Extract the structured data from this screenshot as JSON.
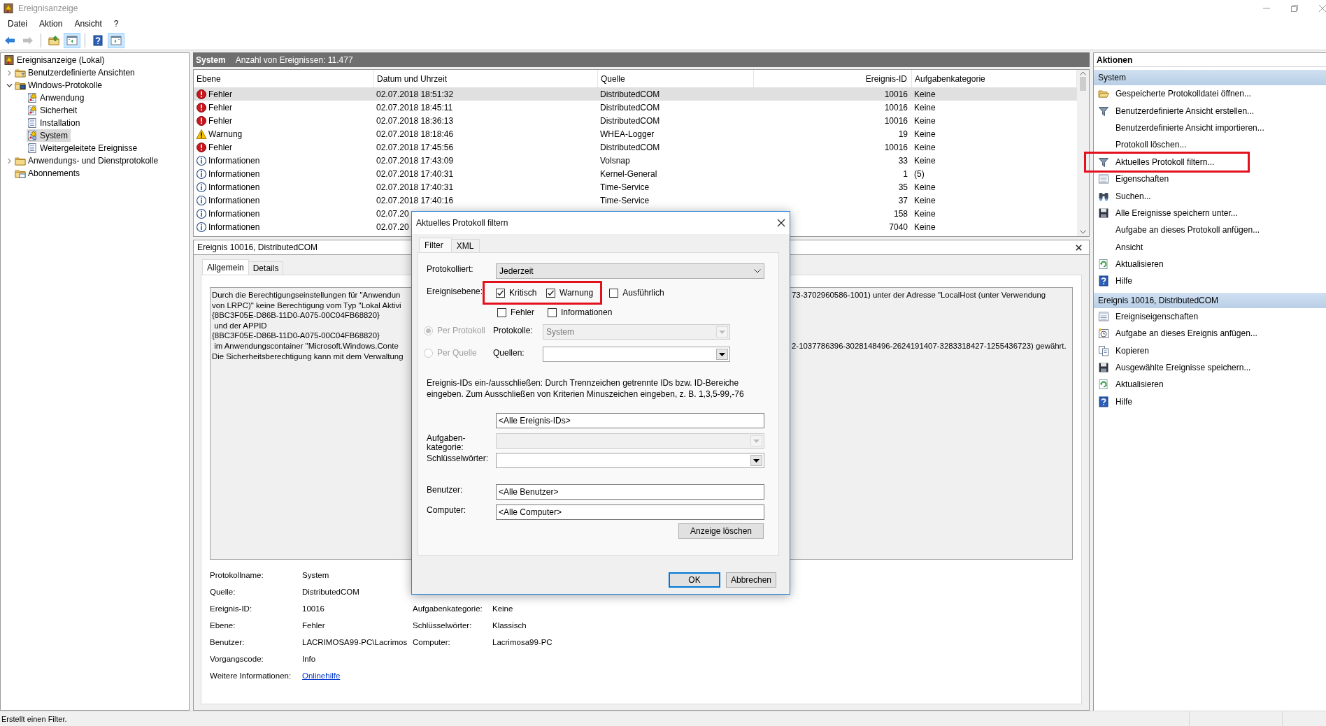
{
  "window": {
    "title": "Ereignisanzeige"
  },
  "menu": [
    "Datei",
    "Aktion",
    "Ansicht",
    "?"
  ],
  "toolbar": [
    {
      "kind": "back",
      "pressed": false,
      "disabled": false
    },
    {
      "kind": "forward",
      "pressed": false,
      "disabled": true
    },
    {
      "kind": "up",
      "pressed": false,
      "disabled": false
    },
    {
      "kind": "tree-pane",
      "pressed": true,
      "disabled": false
    },
    {
      "kind": "help",
      "pressed": false,
      "disabled": false
    },
    {
      "kind": "action-pane",
      "pressed": true,
      "disabled": false
    }
  ],
  "tree": {
    "label": "Ereignisanzeige (Lokal)",
    "kind": "root",
    "selected": false,
    "children": [
      {
        "label": "Benutzerdefinierte Ansichten",
        "kind": "folder-filter",
        "selected": false,
        "expanded": false
      },
      {
        "label": "Windows-Protokolle",
        "kind": "folder-computer",
        "selected": false,
        "expanded": true,
        "children": [
          {
            "label": "Anwendung",
            "kind": "log-alert",
            "selected": false
          },
          {
            "label": "Sicherheit",
            "kind": "log-alert",
            "selected": false
          },
          {
            "label": "Installation",
            "kind": "log",
            "selected": false
          },
          {
            "label": "System",
            "kind": "log-system",
            "selected": true
          },
          {
            "label": "Weitergeleitete Ereignisse",
            "kind": "log",
            "selected": false
          }
        ]
      },
      {
        "label": "Anwendungs- und Dienstprotokolle",
        "kind": "folder",
        "selected": false,
        "expanded": false
      },
      {
        "label": "Abonnements",
        "kind": "folder-subscription",
        "selected": false
      }
    ]
  },
  "log_header": {
    "title": "System",
    "count": "Anzahl von Ereignissen: 11.477"
  },
  "table": {
    "columns": [
      "Ebene",
      "Datum und Uhrzeit",
      "Quelle",
      "Ereignis-ID",
      "Aufgabenkategorie"
    ],
    "rows": [
      {
        "kind": "error",
        "ebene": "Fehler",
        "date": "02.07.2018 18:51:32",
        "source": "DistributedCOM",
        "event_id": "10016",
        "category": "Keine",
        "selected": true
      },
      {
        "kind": "error",
        "ebene": "Fehler",
        "date": "02.07.2018 18:45:11",
        "source": "DistributedCOM",
        "event_id": "10016",
        "category": "Keine",
        "selected": false
      },
      {
        "kind": "error",
        "ebene": "Fehler",
        "date": "02.07.2018 18:36:13",
        "source": "DistributedCOM",
        "event_id": "10016",
        "category": "Keine",
        "selected": false
      },
      {
        "kind": "warning",
        "ebene": "Warnung",
        "date": "02.07.2018 18:18:46",
        "source": "WHEA-Logger",
        "event_id": "19",
        "category": "Keine",
        "selected": false
      },
      {
        "kind": "error",
        "ebene": "Fehler",
        "date": "02.07.2018 17:45:56",
        "source": "DistributedCOM",
        "event_id": "10016",
        "category": "Keine",
        "selected": false
      },
      {
        "kind": "info",
        "ebene": "Informationen",
        "date": "02.07.2018 17:43:09",
        "source": "Volsnap",
        "event_id": "33",
        "category": "Keine",
        "selected": false
      },
      {
        "kind": "info",
        "ebene": "Informationen",
        "date": "02.07.2018 17:40:31",
        "source": "Kernel-General",
        "event_id": "1",
        "category": "(5)",
        "selected": false
      },
      {
        "kind": "info",
        "ebene": "Informationen",
        "date": "02.07.2018 17:40:31",
        "source": "Time-Service",
        "event_id": "35",
        "category": "Keine",
        "selected": false
      },
      {
        "kind": "info",
        "ebene": "Informationen",
        "date": "02.07.2018 17:40:16",
        "source": "Time-Service",
        "event_id": "37",
        "category": "Keine",
        "selected": false
      },
      {
        "kind": "info",
        "ebene": "Informationen",
        "date": "02.07.20",
        "event_id": "158",
        "category": "Keine",
        "selected": false
      },
      {
        "kind": "info",
        "ebene": "Informationen",
        "date": "02.07.20",
        "event_id": "7040",
        "category": "Keine",
        "selected": false
      }
    ]
  },
  "event_detail": {
    "title": "Ereignis 10016, DistributedCOM",
    "tabs": [
      {
        "label": "Allgemein",
        "selected": true
      },
      {
        "label": "Details",
        "selected": false
      }
    ],
    "message_lines": [
      {
        "left": "Durch die Berechtigungseinstellungen für \"Anwendun",
        "right": "73-3702960586-1001) unter der Adresse \"LocalHost (unter Verwendung"
      },
      {
        "left": "von LRPC)\" keine Berechtigung vom Typ \"Lokal Aktivi"
      },
      {
        "left": "{8BC3F05E-D86B-11D0-A075-00C04FB68820}"
      },
      {
        "left": " und der APPID"
      },
      {
        "left": "{8BC3F05E-D86B-11D0-A075-00C04FB68820}"
      },
      {
        "left": " im Anwendungscontainer \"Microsoft.Windows.Conte",
        "right": "2-1037786396-3028148496-2624191407-3283318427-1255436723) gewährt."
      },
      {
        "left": "Die Sicherheitsberechtigung kann mit dem Verwaltung"
      }
    ],
    "properties": [
      {
        "kind": "text",
        "label": "Protokollname:",
        "value": "System"
      },
      {
        "kind": "text",
        "label": "Quelle:",
        "value": "DistributedCOM"
      },
      {
        "kind": "text",
        "label": "Ereignis-ID:",
        "value": "10016",
        "label_2": "Aufgabenkategorie:",
        "value_2": "Keine"
      },
      {
        "kind": "text",
        "label": "Ebene:",
        "value": "Fehler",
        "label_2": "Schlüsselwörter:",
        "value_2": "Klassisch"
      },
      {
        "kind": "text",
        "label": "Benutzer:",
        "value": "LACRIMOSA99-PC\\Lacrimos",
        "label_2": "Computer:",
        "value_2": "Lacrimosa99-PC"
      },
      {
        "kind": "text",
        "label": "Vorgangscode:",
        "value": "Info"
      },
      {
        "kind": "link",
        "label": "Weitere Informationen:",
        "value": "Onlinehilfe"
      }
    ]
  },
  "actions": {
    "title": "Aktionen",
    "sections": [
      {
        "title": "System",
        "items": [
          {
            "kind": "open-folder",
            "label": "Gespeicherte Protokolldatei öffnen...",
            "highlighted": false
          },
          {
            "kind": "filter",
            "label": "Benutzerdefinierte Ansicht erstellen...",
            "highlighted": false
          },
          {
            "kind": "plain",
            "label": "Benutzerdefinierte Ansicht importieren...",
            "highlighted": false
          },
          {
            "kind": "plain",
            "label": "Protokoll löschen...",
            "highlighted": false
          },
          {
            "kind": "filter",
            "label": "Aktuelles Protokoll filtern...",
            "highlighted": true
          },
          {
            "kind": "properties",
            "label": "Eigenschaften",
            "highlighted": false
          },
          {
            "kind": "binoculars",
            "label": "Suchen...",
            "highlighted": false
          },
          {
            "kind": "save",
            "label": "Alle Ereignisse speichern unter...",
            "highlighted": false
          },
          {
            "kind": "plain",
            "label": "Aufgabe an dieses Protokoll anfügen...",
            "highlighted": false
          },
          {
            "kind": "plain",
            "label": "Ansicht",
            "highlighted": false
          },
          {
            "kind": "refresh",
            "label": "Aktualisieren",
            "highlighted": false
          },
          {
            "kind": "help",
            "label": "Hilfe",
            "highlighted": false
          }
        ]
      },
      {
        "title": "Ereignis 10016, DistributedCOM",
        "items": [
          {
            "kind": "properties",
            "label": "Ereigniseigenschaften",
            "highlighted": false
          },
          {
            "kind": "task",
            "label": "Aufgabe an dieses Ereignis anfügen...",
            "highlighted": false
          },
          {
            "kind": "copy",
            "label": "Kopieren",
            "highlighted": false
          },
          {
            "kind": "save",
            "label": "Ausgewählte Ereignisse speichern...",
            "highlighted": false
          },
          {
            "kind": "refresh",
            "label": "Aktualisieren",
            "highlighted": false
          },
          {
            "kind": "help",
            "label": "Hilfe",
            "highlighted": false
          }
        ]
      }
    ]
  },
  "filter_dialog": {
    "title": "Aktuelles Protokoll filtern",
    "tabs": [
      {
        "label": "Filter",
        "selected": true
      },
      {
        "label": "XML",
        "selected": false
      }
    ],
    "logged": {
      "label": "Protokolliert:",
      "value": "Jederzeit"
    },
    "event_levels": {
      "label": "Ereignisebene:",
      "options": [
        {
          "label": "Kritisch",
          "checked": true,
          "highlighted": true
        },
        {
          "label": "Warnung",
          "checked": true,
          "highlighted": true
        },
        {
          "label": "Ausführlich",
          "checked": false,
          "highlighted": false
        },
        {
          "label": "Fehler",
          "checked": false,
          "highlighted": false
        },
        {
          "label": "Informationen",
          "checked": false,
          "highlighted": false
        }
      ]
    },
    "scope": [
      {
        "label": "Per Protokoll",
        "selected": true,
        "disabled": true,
        "field_label": "Protokolle:",
        "value": "System",
        "field_disabled": true
      },
      {
        "label": "Per Quelle",
        "selected": false,
        "disabled": true,
        "field_label": "Quellen:",
        "field_disabled": false
      }
    ],
    "id_hint": "Ereignis-IDs ein-/ausschließen: Durch Trennzeichen getrennte IDs bzw. ID-Bereiche eingeben. Zum Ausschließen von Kriterien Minuszeichen eingeben, z. B. 1,3,5-99,-76",
    "fields": [
      {
        "kind": "input",
        "value": "<Alle Ereignis-IDs>"
      },
      {
        "kind": "combo",
        "label": "Aufgaben-kategorie:",
        "disabled": true
      },
      {
        "kind": "combo",
        "label": "Schlüsselwörter:",
        "disabled": false
      },
      {
        "kind": "input",
        "label": "Benutzer:",
        "value": "<Alle Benutzer>"
      },
      {
        "kind": "input",
        "label": "Computer:",
        "value": "<Alle Computer>"
      }
    ],
    "clear_button": "Anzeige löschen",
    "ok_button": "OK",
    "cancel_button": "Abbrechen"
  },
  "status_bar": {
    "text": "Erstellt einen Filter."
  }
}
